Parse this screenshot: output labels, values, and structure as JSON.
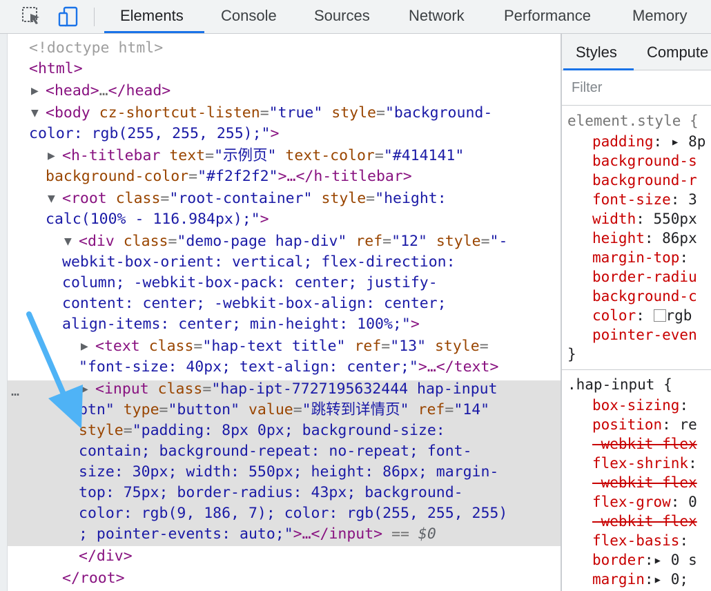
{
  "toolbar": {
    "tabs": [
      "Elements",
      "Console",
      "Sources",
      "Network",
      "Performance",
      "Memory"
    ],
    "active_tab": "Elements",
    "accent": "#1a73e8"
  },
  "dom": {
    "doctype": "<!doctype html>",
    "html_open": "<html>",
    "head": {
      "open": "<head>",
      "ellipsis": "…",
      "close": "</head>"
    },
    "body": {
      "open": "<body",
      "attr1_name": "cz-shortcut-listen",
      "attr1_value": "\"true\"",
      "attr2_name": "style",
      "attr2_value_a": "\"background-",
      "attr2_value_b": "color: rgb(255, 255, 255);\"",
      "close_bracket": ">"
    },
    "titlebar": {
      "open": "<h-titlebar",
      "a1n": "text",
      "a1v": "\"示例页\"",
      "a2n": "text-color",
      "a2v": "\"#414141\"",
      "a3n": "background-color",
      "a3v": "\"#f2f2f2\"",
      "rest": ">…</h-titlebar>"
    },
    "root": {
      "open": "<root",
      "a1n": "class",
      "a1v": "\"root-container\"",
      "a2n": "style",
      "a2v_a": "\"height:",
      "a2v_b": "calc(100% - 116.984px);\"",
      "close_bracket": ">"
    },
    "div": {
      "open": "<div",
      "a1n": "class",
      "a1v": "\"demo-page hap-div\"",
      "a2n": "ref",
      "a2v": "\"12\"",
      "a3n": "style",
      "a3v_1": "\"-",
      "a3v_2": "webkit-box-orient: vertical; flex-direction:",
      "a3v_3": "column; -webkit-box-pack: center; justify-",
      "a3v_4": "content: center; -webkit-box-align: center;",
      "a3v_5": "align-items: center; min-height: 100%;\"",
      "close_bracket": ">"
    },
    "text": {
      "open": "<text",
      "a1n": "class",
      "a1v": "\"hap-text title\"",
      "a2n": "ref",
      "a2v": "\"13\"",
      "a3n": "style",
      "a3v_a": "\"font-size: 40px; text-align: center;\"",
      "rest": ">…</text>"
    },
    "input": {
      "dots": "…",
      "open": "<input",
      "a1n": "class",
      "a1v_a": "\"hap-ipt-7727195632444 hap-input",
      "a1v_b": "btn\"",
      "a2n": "type",
      "a2v": "\"button\"",
      "a3n": "value",
      "a3v": "\"跳转到详情页\"",
      "a4n": "ref",
      "a4v": "\"14\"",
      "a5n": "style",
      "s1": "\"padding: 8px 0px; background-size:",
      "s2": "contain; background-repeat: no-repeat; font-",
      "s3": "size: 30px; width: 550px; height: 86px; margin-",
      "s4": "top: 75px; border-radius: 43px; background-",
      "s5": "color: rgb(9, 186, 7); color: rgb(255, 255, 255)",
      "s6": "; pointer-events: auto;\"",
      "rest": ">…</input>",
      "eq": " == ",
      "marker": "$0"
    },
    "div_close": "</div>",
    "root_close": "</root>"
  },
  "styles": {
    "tabs": [
      "Styles",
      "Compute"
    ],
    "filter_placeholder": "Filter",
    "element_style": {
      "selector": "element.style {",
      "props": [
        {
          "name": "padding",
          "value": ": ▸ 8p"
        },
        {
          "name": "background-s",
          "value": ""
        },
        {
          "name": "background-r",
          "value": ""
        },
        {
          "name": "font-size",
          "value": ": 3"
        },
        {
          "name": "width",
          "value": ": 550px"
        },
        {
          "name": "height",
          "value": ": 86px"
        },
        {
          "name": "margin-top",
          "value": ":"
        },
        {
          "name": "border-radiu",
          "value": ""
        },
        {
          "name": "background-c",
          "value": ""
        },
        {
          "name": "color",
          "value": "rgb"
        },
        {
          "name": "pointer-even",
          "value": ""
        }
      ],
      "close": "}"
    },
    "hap_input": {
      "selector": ".hap-input {",
      "props": [
        {
          "name": "box-sizing",
          "value": ":"
        },
        {
          "name": "position",
          "value": ": re"
        },
        {
          "name": "-webkit-flex",
          "value": "",
          "struck": true
        },
        {
          "name": "flex-shrink",
          "value": ":"
        },
        {
          "name": "-webkit-flex",
          "value": "",
          "struck": true
        },
        {
          "name": "flex-grow",
          "value": ": 0"
        },
        {
          "name": "-webkit-flex",
          "value": "",
          "struck": true
        },
        {
          "name": "flex-basis",
          "value": ":"
        },
        {
          "name": "border",
          "value": ":▸ 0 s"
        },
        {
          "name": "margin",
          "value": ":▸ 0;"
        }
      ]
    }
  },
  "annotation": {
    "arrow_color": "#4fb3f6"
  }
}
